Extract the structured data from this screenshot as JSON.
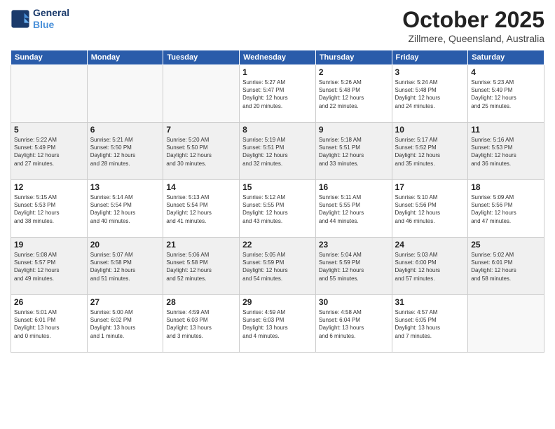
{
  "header": {
    "logo_line1": "General",
    "logo_line2": "Blue",
    "month": "October 2025",
    "location": "Zillmere, Queensland, Australia"
  },
  "weekdays": [
    "Sunday",
    "Monday",
    "Tuesday",
    "Wednesday",
    "Thursday",
    "Friday",
    "Saturday"
  ],
  "weeks": [
    {
      "shaded": false,
      "days": [
        {
          "num": "",
          "info": ""
        },
        {
          "num": "",
          "info": ""
        },
        {
          "num": "",
          "info": ""
        },
        {
          "num": "1",
          "info": "Sunrise: 5:27 AM\nSunset: 5:47 PM\nDaylight: 12 hours\nand 20 minutes."
        },
        {
          "num": "2",
          "info": "Sunrise: 5:26 AM\nSunset: 5:48 PM\nDaylight: 12 hours\nand 22 minutes."
        },
        {
          "num": "3",
          "info": "Sunrise: 5:24 AM\nSunset: 5:48 PM\nDaylight: 12 hours\nand 24 minutes."
        },
        {
          "num": "4",
          "info": "Sunrise: 5:23 AM\nSunset: 5:49 PM\nDaylight: 12 hours\nand 25 minutes."
        }
      ]
    },
    {
      "shaded": true,
      "days": [
        {
          "num": "5",
          "info": "Sunrise: 5:22 AM\nSunset: 5:49 PM\nDaylight: 12 hours\nand 27 minutes."
        },
        {
          "num": "6",
          "info": "Sunrise: 5:21 AM\nSunset: 5:50 PM\nDaylight: 12 hours\nand 28 minutes."
        },
        {
          "num": "7",
          "info": "Sunrise: 5:20 AM\nSunset: 5:50 PM\nDaylight: 12 hours\nand 30 minutes."
        },
        {
          "num": "8",
          "info": "Sunrise: 5:19 AM\nSunset: 5:51 PM\nDaylight: 12 hours\nand 32 minutes."
        },
        {
          "num": "9",
          "info": "Sunrise: 5:18 AM\nSunset: 5:51 PM\nDaylight: 12 hours\nand 33 minutes."
        },
        {
          "num": "10",
          "info": "Sunrise: 5:17 AM\nSunset: 5:52 PM\nDaylight: 12 hours\nand 35 minutes."
        },
        {
          "num": "11",
          "info": "Sunrise: 5:16 AM\nSunset: 5:53 PM\nDaylight: 12 hours\nand 36 minutes."
        }
      ]
    },
    {
      "shaded": false,
      "days": [
        {
          "num": "12",
          "info": "Sunrise: 5:15 AM\nSunset: 5:53 PM\nDaylight: 12 hours\nand 38 minutes."
        },
        {
          "num": "13",
          "info": "Sunrise: 5:14 AM\nSunset: 5:54 PM\nDaylight: 12 hours\nand 40 minutes."
        },
        {
          "num": "14",
          "info": "Sunrise: 5:13 AM\nSunset: 5:54 PM\nDaylight: 12 hours\nand 41 minutes."
        },
        {
          "num": "15",
          "info": "Sunrise: 5:12 AM\nSunset: 5:55 PM\nDaylight: 12 hours\nand 43 minutes."
        },
        {
          "num": "16",
          "info": "Sunrise: 5:11 AM\nSunset: 5:55 PM\nDaylight: 12 hours\nand 44 minutes."
        },
        {
          "num": "17",
          "info": "Sunrise: 5:10 AM\nSunset: 5:56 PM\nDaylight: 12 hours\nand 46 minutes."
        },
        {
          "num": "18",
          "info": "Sunrise: 5:09 AM\nSunset: 5:56 PM\nDaylight: 12 hours\nand 47 minutes."
        }
      ]
    },
    {
      "shaded": true,
      "days": [
        {
          "num": "19",
          "info": "Sunrise: 5:08 AM\nSunset: 5:57 PM\nDaylight: 12 hours\nand 49 minutes."
        },
        {
          "num": "20",
          "info": "Sunrise: 5:07 AM\nSunset: 5:58 PM\nDaylight: 12 hours\nand 51 minutes."
        },
        {
          "num": "21",
          "info": "Sunrise: 5:06 AM\nSunset: 5:58 PM\nDaylight: 12 hours\nand 52 minutes."
        },
        {
          "num": "22",
          "info": "Sunrise: 5:05 AM\nSunset: 5:59 PM\nDaylight: 12 hours\nand 54 minutes."
        },
        {
          "num": "23",
          "info": "Sunrise: 5:04 AM\nSunset: 5:59 PM\nDaylight: 12 hours\nand 55 minutes."
        },
        {
          "num": "24",
          "info": "Sunrise: 5:03 AM\nSunset: 6:00 PM\nDaylight: 12 hours\nand 57 minutes."
        },
        {
          "num": "25",
          "info": "Sunrise: 5:02 AM\nSunset: 6:01 PM\nDaylight: 12 hours\nand 58 minutes."
        }
      ]
    },
    {
      "shaded": false,
      "days": [
        {
          "num": "26",
          "info": "Sunrise: 5:01 AM\nSunset: 6:01 PM\nDaylight: 13 hours\nand 0 minutes."
        },
        {
          "num": "27",
          "info": "Sunrise: 5:00 AM\nSunset: 6:02 PM\nDaylight: 13 hours\nand 1 minute."
        },
        {
          "num": "28",
          "info": "Sunrise: 4:59 AM\nSunset: 6:03 PM\nDaylight: 13 hours\nand 3 minutes."
        },
        {
          "num": "29",
          "info": "Sunrise: 4:59 AM\nSunset: 6:03 PM\nDaylight: 13 hours\nand 4 minutes."
        },
        {
          "num": "30",
          "info": "Sunrise: 4:58 AM\nSunset: 6:04 PM\nDaylight: 13 hours\nand 6 minutes."
        },
        {
          "num": "31",
          "info": "Sunrise: 4:57 AM\nSunset: 6:05 PM\nDaylight: 13 hours\nand 7 minutes."
        },
        {
          "num": "",
          "info": ""
        }
      ]
    }
  ]
}
